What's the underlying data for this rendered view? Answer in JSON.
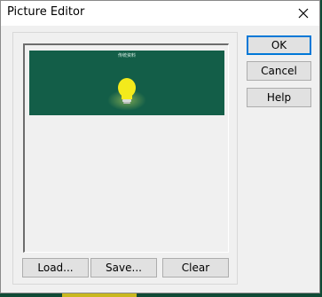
{
  "window": {
    "title": "Picture Editor",
    "close_icon": "close-icon"
  },
  "preview": {
    "caption": "传统资料"
  },
  "actions": {
    "load_label": "Load...",
    "save_label": "Save...",
    "clear_label": "Clear"
  },
  "side_buttons": {
    "ok_label": "OK",
    "cancel_label": "Cancel",
    "help_label": "Help"
  },
  "colors": {
    "picture_background": "#135e48",
    "bulb": "#f3ea1c",
    "accent_focus": "#0078d7"
  }
}
